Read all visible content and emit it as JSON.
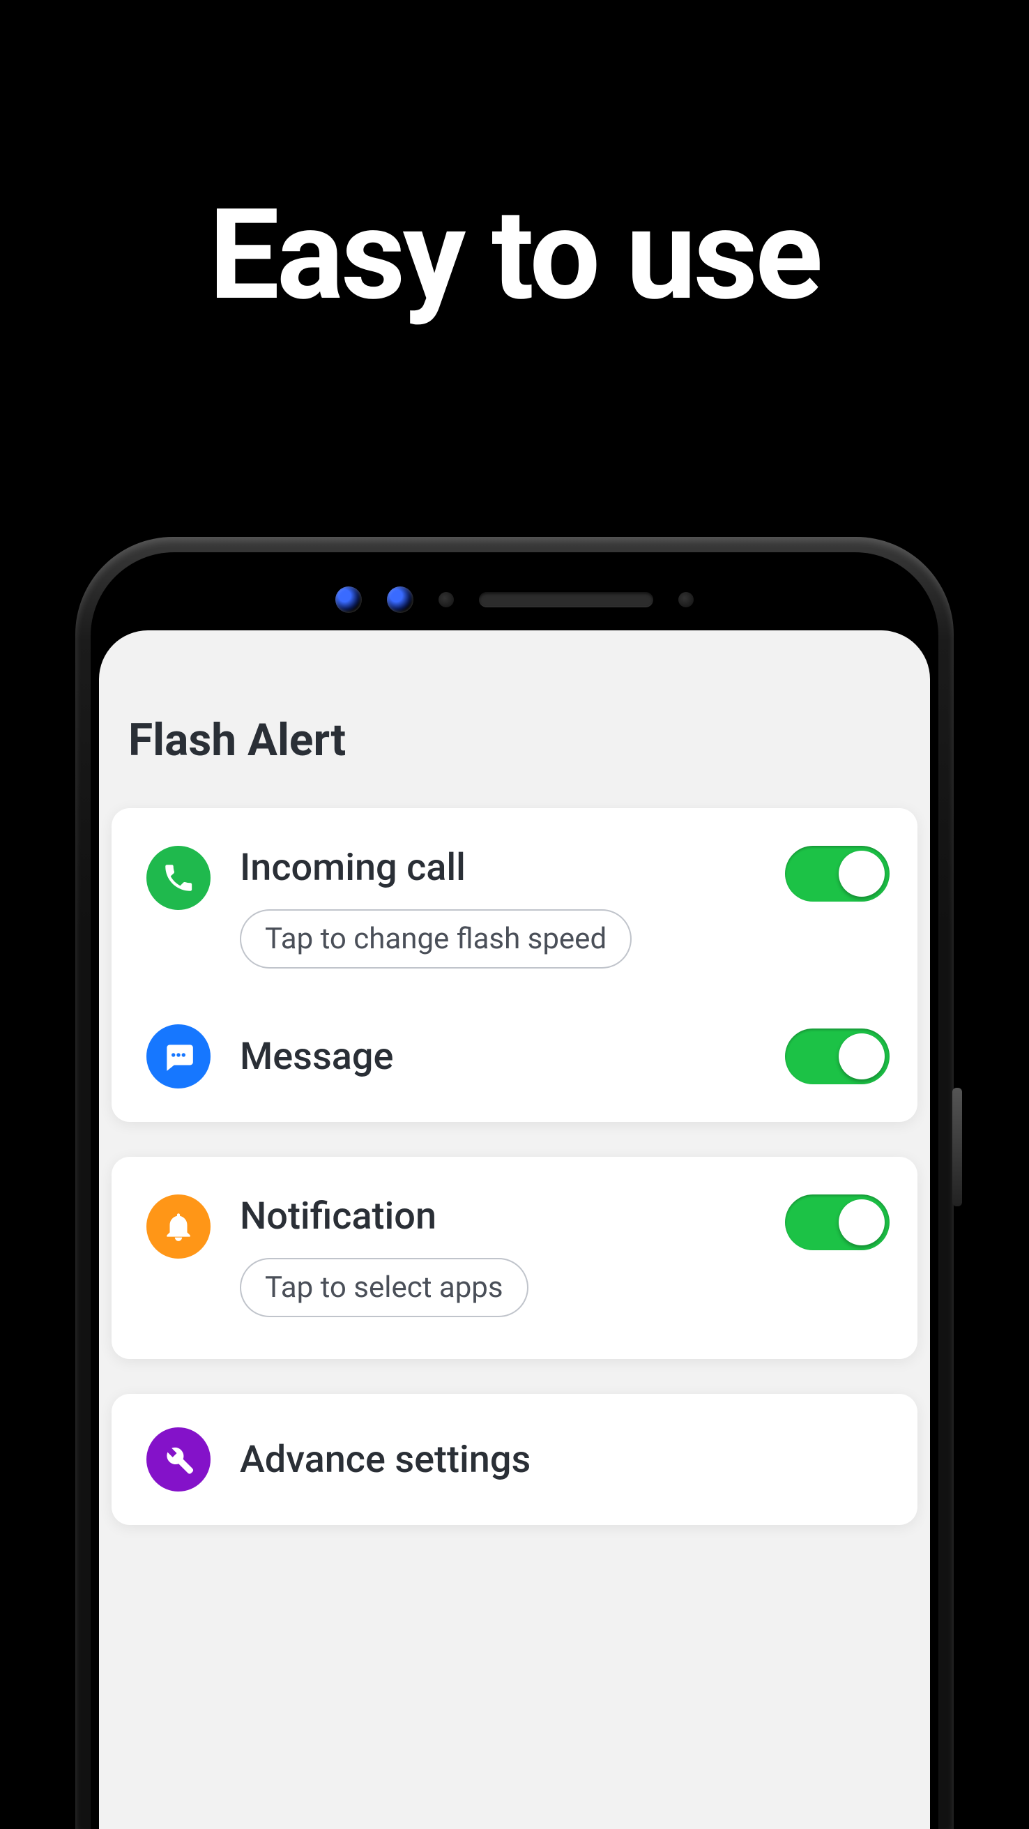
{
  "headline": "Easy to use",
  "screen": {
    "title": "Flash Alert",
    "groups": [
      {
        "rows": [
          {
            "id": "incoming-call",
            "title": "Incoming call",
            "chip": "Tap to change flash speed",
            "toggle": true,
            "icon": "phone-icon",
            "icon_color": "green"
          },
          {
            "id": "message",
            "title": "Message",
            "toggle": true,
            "icon": "message-icon",
            "icon_color": "blue"
          }
        ]
      },
      {
        "rows": [
          {
            "id": "notification",
            "title": "Notification",
            "chip": "Tap to select apps",
            "toggle": true,
            "icon": "bell-icon",
            "icon_color": "orange"
          }
        ]
      },
      {
        "rows": [
          {
            "id": "advance-settings",
            "title": "Advance settings",
            "icon": "wrench-icon",
            "icon_color": "purple"
          }
        ]
      }
    ]
  }
}
